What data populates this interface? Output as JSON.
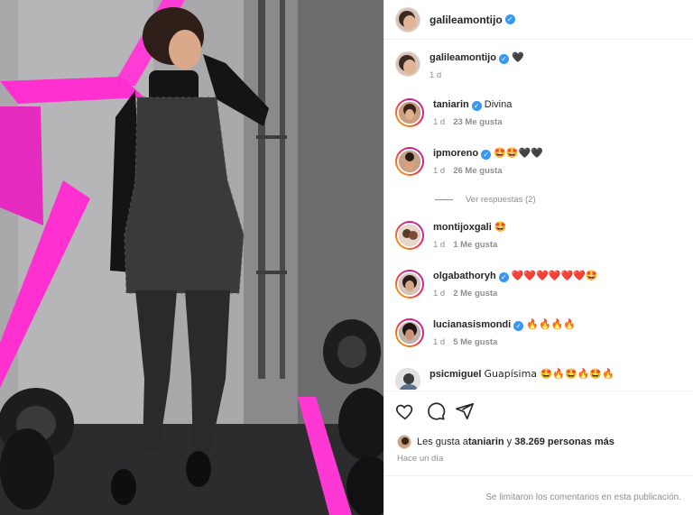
{
  "post": {
    "author": "galileamontijo",
    "author_verified": true,
    "photo_alt": "photo"
  },
  "caption": {
    "username": "galileamontijo",
    "text": "🖤",
    "time": "1 d"
  },
  "comments": [
    {
      "username": "taniarin",
      "verified": true,
      "text": "Divina",
      "time": "1 d",
      "likes": "23 Me gusta"
    },
    {
      "username": "ipmoreno",
      "verified": true,
      "text": "🤩🤩🖤🖤",
      "time": "1 d",
      "likes": "26 Me gusta"
    },
    {
      "username": "montijoxgali",
      "verified": false,
      "text": "🤩",
      "time": "1 d",
      "likes": "1 Me gusta"
    },
    {
      "username": "olgabathoryh",
      "verified": true,
      "text": "❤️❤️❤️❤️❤️❤️🤩",
      "time": "1 d",
      "likes": "2 Me gusta"
    },
    {
      "username": "lucianasismondi",
      "verified": true,
      "text": "🔥🔥🔥🔥",
      "time": "1 d",
      "likes": "5 Me gusta"
    },
    {
      "username": "psicmiguel",
      "verified": false,
      "text": "Guapísima 🤩🔥🤩🔥🤩🔥",
      "time": "",
      "likes": ""
    }
  ],
  "replies_label": "Ver respuestas (2)",
  "likes_summary": {
    "prefix": "Les gusta a ",
    "user": "taniarin",
    "middle": " y ",
    "count": "38.269 personas más"
  },
  "posted_ago": "Hace un día",
  "comments_limited": "Se limitaron los comentarios en esta publicación.",
  "colors": {
    "verified": "#3897f0",
    "neon_pink": "#ff2fd0",
    "ring_gradient": [
      "#f9c300",
      "#f2592e",
      "#d8207e",
      "#b52cb4"
    ]
  },
  "icons": [
    "heart-icon",
    "comment-icon",
    "share-icon",
    "verified-badge-icon"
  ]
}
